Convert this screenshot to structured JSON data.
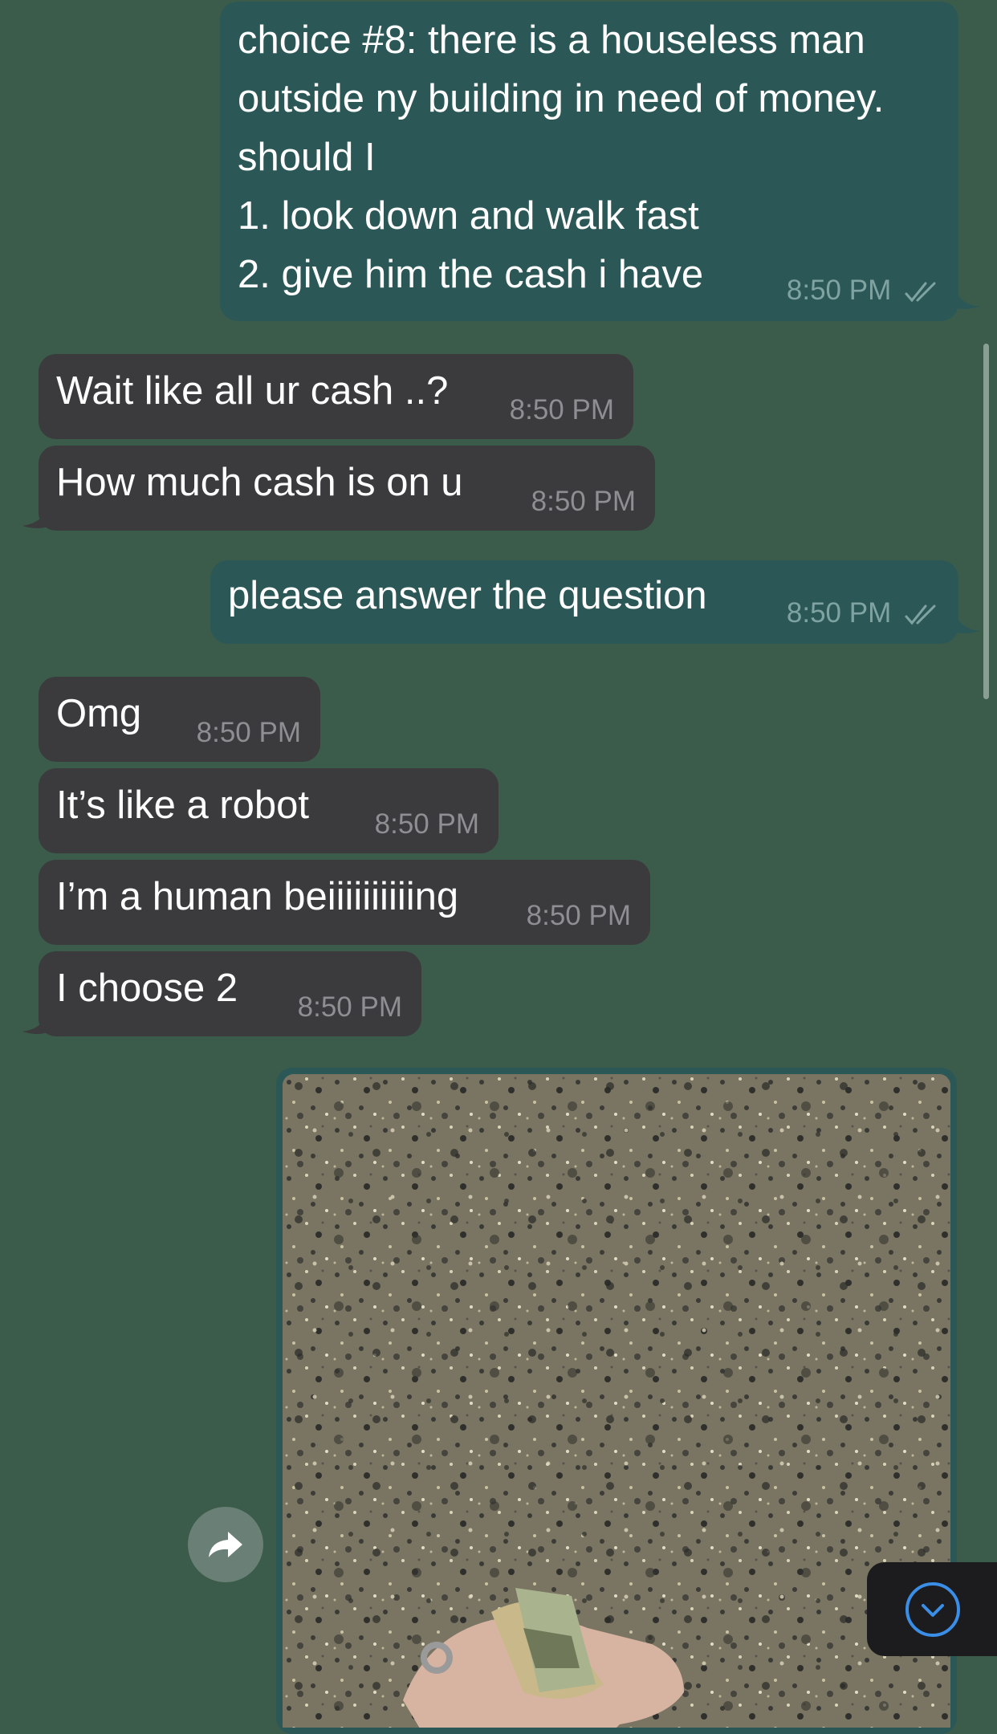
{
  "colors": {
    "background": "#3b5c4b",
    "incoming_bubble": "#3b3a3d",
    "outgoing_bubble": "#2b5857",
    "timestamp_incoming": "#8e8e93",
    "timestamp_outgoing": "#7fa3a1",
    "accent": "#3a8ee6"
  },
  "messages": [
    {
      "direction": "outgoing",
      "lines": [
        "choice #8: there is a houseless man",
        "outside ny building in need of money.",
        "should I",
        "1. look down and walk fast",
        "2. give him the cash i have"
      ],
      "time": "8:50 PM",
      "status": "read"
    },
    {
      "direction": "incoming",
      "text": "Wait like all ur cash ..?",
      "time": "8:50 PM"
    },
    {
      "direction": "incoming",
      "text": "How much cash is on u",
      "time": "8:50 PM"
    },
    {
      "direction": "outgoing",
      "text": "please answer the question",
      "time": "8:50 PM",
      "status": "read"
    },
    {
      "direction": "incoming",
      "text": "Omg",
      "time": "8:50 PM"
    },
    {
      "direction": "incoming",
      "text": "It’s like a robot",
      "time": "8:50 PM"
    },
    {
      "direction": "incoming",
      "text": "I’m a human beiiiiiiiiiing",
      "time": "8:50 PM"
    },
    {
      "direction": "incoming",
      "text": "I choose 2",
      "time": "8:50 PM"
    },
    {
      "direction": "outgoing",
      "type": "photo",
      "photo_description_icon": "photo-hand-holding-cash-icon"
    }
  ],
  "icons": {
    "read_receipt": "double-check-icon",
    "forward": "forward-arrow-icon",
    "scroll_down": "chevron-down-circle-icon"
  }
}
